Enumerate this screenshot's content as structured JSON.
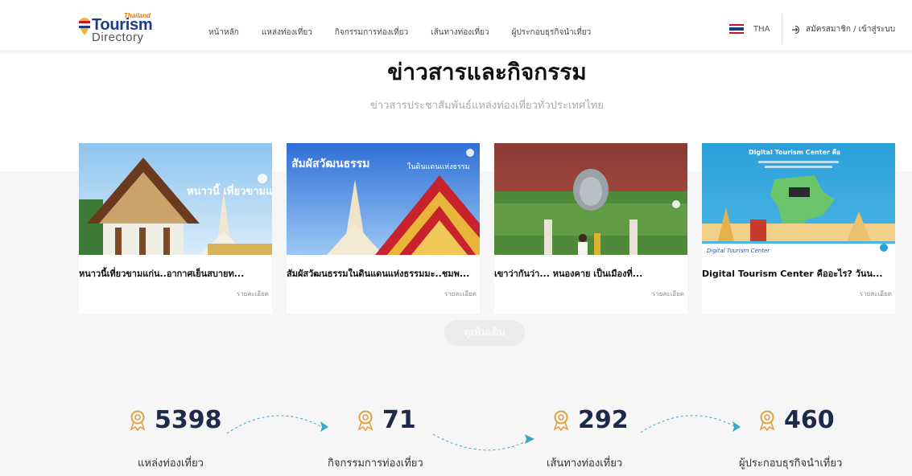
{
  "header": {
    "logo": {
      "thailand": "Thailand",
      "tourism": "Tourism",
      "directory": "Directory"
    },
    "nav": [
      "หน้าหลัก",
      "แหล่งท่องเที่ยว",
      "กิจกรรมการท่องเที่ยว",
      "เส้นทางท่องเที่ยว",
      "ผู้ประกอบธุรกิจนำเที่ยว"
    ],
    "language": "THA",
    "login": "สมัครสมาชิก / เข้าสู่ระบบ"
  },
  "section": {
    "title": "ข่าวสารและกิจกรรม",
    "subtitle": "ข่าวสารประชาสัมพันธ์แหล่งท่องเที่ยวทั่วประเทศไทย"
  },
  "cards": [
    {
      "title": "หนาวนี้เที่ยวขามแก่น..อากาศเย็นสบายท...",
      "link": "รายละเอียด",
      "image_text": "หนาวนี้ เที่ยวขามแก่น"
    },
    {
      "title": "สัมผัสวัฒนธรรมในดินแดนแห่งธรรมมะ..ชมพ...",
      "link": "รายละเอียด",
      "image_text_a": "สัมผัสวัฒนธรรม",
      "image_text_b": "ในดินแดนแห่งธรรม"
    },
    {
      "title": "เขาว่ากันว่า... หนองคาย เป็นเมืองที่...",
      "link": "รายละเอียด"
    },
    {
      "title": "Digital Tourism Center คืออะไร? วันน...",
      "link": "รายละเอียด",
      "image_text_a": "Digital Tourism Center คือ",
      "image_text_b": "Digital Tourism Center"
    }
  ],
  "more_button": "ดูเพิ่มเติม",
  "stats": [
    {
      "value": "5398",
      "label": "แหล่งท่องเที่ยว"
    },
    {
      "value": "71",
      "label": "กิจกรรมการท่องเที่ยว"
    },
    {
      "value": "292",
      "label": "เส้นทางท่องเที่ยว"
    },
    {
      "value": "460",
      "label": "ผู้ประกอบธุรกิจนำเที่ยว"
    }
  ],
  "colors": {
    "navy": "#1e2a4a",
    "accent_orange": "#e0a040",
    "arrow_teal": "#3aa8c4"
  }
}
